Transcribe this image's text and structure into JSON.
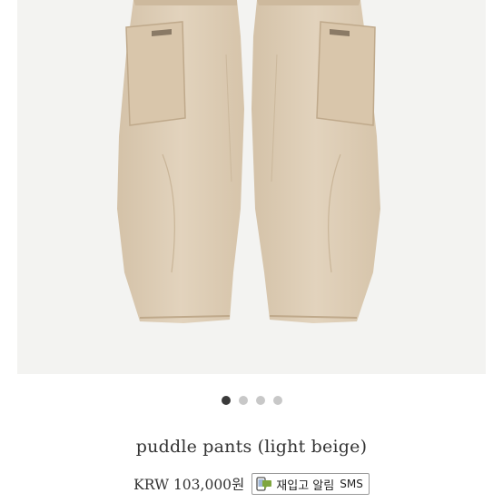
{
  "product": {
    "name": "puddle pants (light beige)",
    "price": "KRW 103,000원"
  },
  "carousel": {
    "total_slides": 4,
    "active_index": 0
  },
  "restock": {
    "label": "재입고 알림",
    "channel": "SMS",
    "icon": "phone-message-icon"
  },
  "colors": {
    "dot_active": "#3a3a3a",
    "dot_inactive": "#c8c8c8",
    "pants_beige": "#dccbb2",
    "background": "#f3f3f1"
  }
}
